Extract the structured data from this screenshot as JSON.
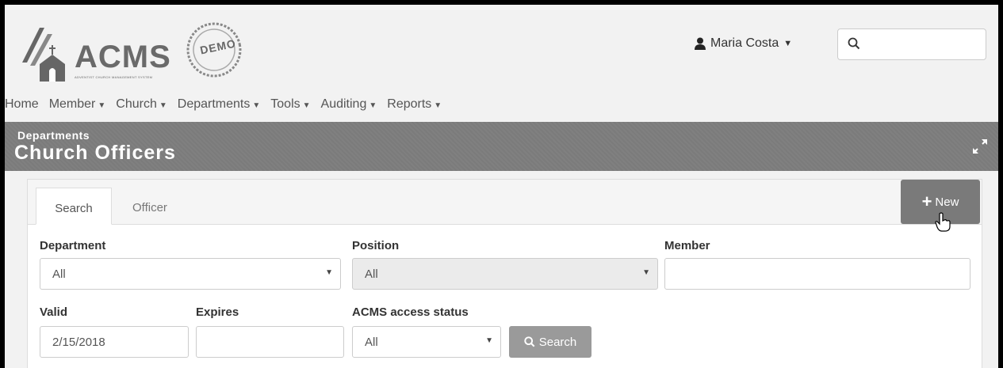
{
  "header": {
    "logo_text": "ACMS",
    "logo_subtitle": "ADVENTIST CHURCH MANAGEMENT SYSTEM",
    "demo_stamp": "DEMO",
    "user_name": "Maria Costa",
    "search_placeholder": ""
  },
  "nav": {
    "items": [
      {
        "label": "Home"
      },
      {
        "label": "Member"
      },
      {
        "label": "Church"
      },
      {
        "label": "Departments"
      },
      {
        "label": "Tools"
      },
      {
        "label": "Auditing"
      },
      {
        "label": "Reports"
      }
    ]
  },
  "banner": {
    "breadcrumb": "Departments",
    "title": "Church Officers"
  },
  "tabs": {
    "search": "Search",
    "officer": "Officer",
    "new_label": "New"
  },
  "form": {
    "department_label": "Department",
    "department_value": "All",
    "position_label": "Position",
    "position_value": "All",
    "member_label": "Member",
    "member_value": "",
    "valid_label": "Valid",
    "valid_value": "2/15/2018",
    "expires_label": "Expires",
    "expires_value": "",
    "access_label": "ACMS access status",
    "access_value": "All",
    "search_button": "Search"
  },
  "colors": {
    "banner": "#7b7b7b",
    "new_button": "#7a7a7a",
    "search_button": "#9a9a9a",
    "page_bg": "#f2f2f2"
  }
}
